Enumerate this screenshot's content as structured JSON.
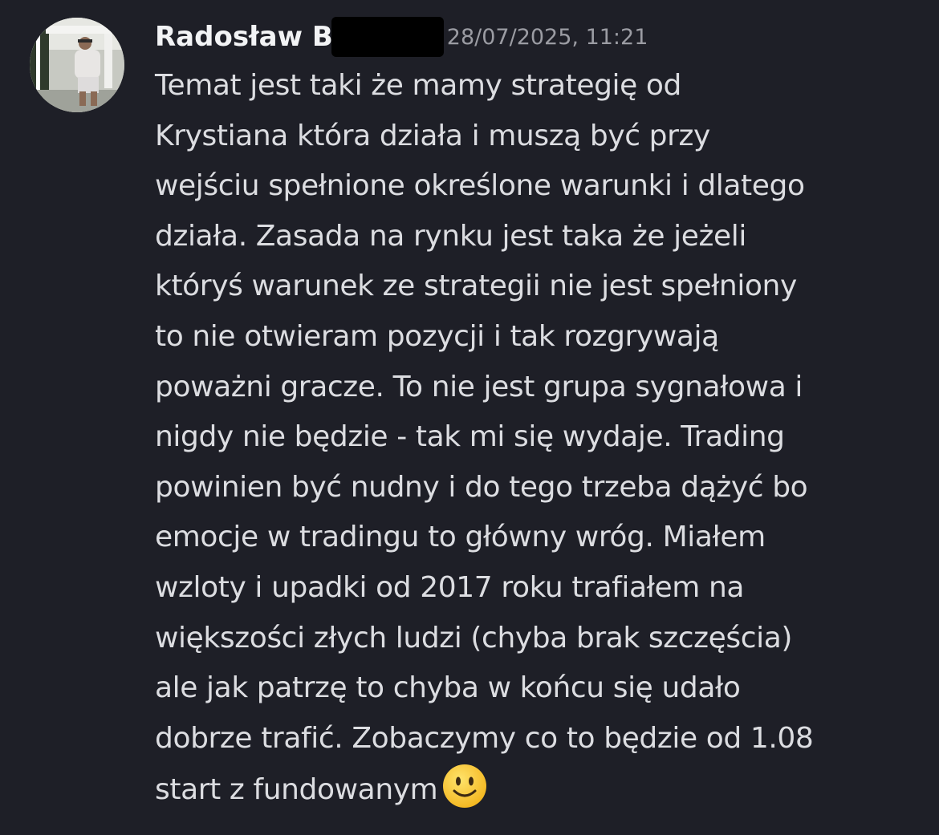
{
  "message": {
    "author": "Radosław B",
    "timestamp": "28/07/2025, 11:21",
    "lines": [
      "Temat jest taki że mamy strategię od",
      "Krystiana która działa i muszą być przy",
      "wejściu spełnione określone warunki i dlatego",
      "działa. Zasada na rynku jest taka że jeżeli",
      "któryś warunek ze strategii nie jest spełniony",
      "to nie otwieram pozycji i tak rozgrywają",
      "poważni gracze. To nie jest grupa sygnałowa i",
      "nigdy nie będzie - tak mi się wydaje. Trading",
      "powinien być nudny i do tego trzeba dążyć bo",
      "emocje w tradingu to główny wróg. Miałem",
      "wzloty i upadki od 2017 roku trafiałem na",
      "większości złych ludzi (chyba brak szczęścia)",
      "ale jak patrzę to chyba w końcu się udało",
      "dobrze trafić. Zobaczymy co to będzie od 1.08",
      "start z fundowanym"
    ],
    "emoji": "slightly-smiling-face-icon"
  },
  "colors": {
    "background": "#1e1f27",
    "author": "#f2f3f5",
    "text": "#dcdde1",
    "timestamp": "#9b9ca3",
    "emoji": "#f7c431"
  }
}
